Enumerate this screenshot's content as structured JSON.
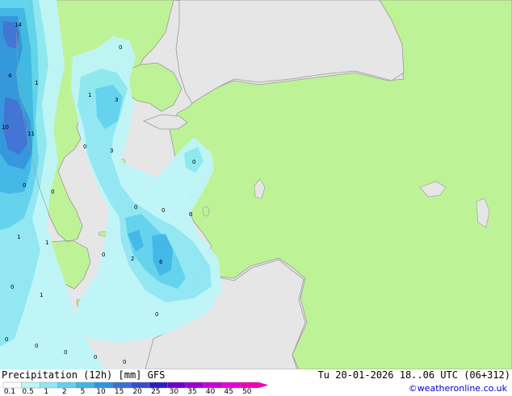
{
  "map": {
    "labels": [
      {
        "text": "14"
      },
      {
        "text": "4"
      },
      {
        "text": "1"
      },
      {
        "text": "10"
      },
      {
        "text": "11"
      },
      {
        "text": "1"
      },
      {
        "text": "3"
      },
      {
        "text": "0"
      },
      {
        "text": "3"
      },
      {
        "text": "0"
      },
      {
        "text": "0"
      },
      {
        "text": "0"
      },
      {
        "text": "0"
      },
      {
        "text": "1"
      },
      {
        "text": "1"
      },
      {
        "text": "0"
      },
      {
        "text": "2"
      },
      {
        "text": "6"
      },
      {
        "text": "0"
      },
      {
        "text": "1"
      },
      {
        "text": "0"
      },
      {
        "text": "0"
      },
      {
        "text": "0"
      },
      {
        "text": "0"
      },
      {
        "text": "0"
      },
      {
        "text": "0"
      },
      {
        "text": "0"
      },
      {
        "text": "0"
      }
    ]
  },
  "footer": {
    "title": "Precipitation (12h) [mm] GFS",
    "datetime": "Tu 20-01-2026 18..06 UTC (06+312)",
    "credit": "©weatheronline.co.uk"
  },
  "legend": {
    "ticks": [
      "0.1",
      "0.5",
      "1",
      "2",
      "5",
      "10",
      "15",
      "20",
      "25",
      "30",
      "35",
      "40",
      "45",
      "50"
    ],
    "colors": [
      "#ffffff",
      "#bff6fa",
      "#8ee8f4",
      "#5fd2ee",
      "#3cb6e6",
      "#2d94dc",
      "#3a6fd4",
      "#3a4ccc",
      "#2a22c0",
      "#6a00cc",
      "#9a00d0",
      "#c800d8",
      "#e400d8",
      "#f000b4"
    ]
  },
  "colors": {
    "sea": "#e6e6e6",
    "land": "#bef296",
    "coast": "#999999",
    "accent_credit": "#0000cc"
  }
}
